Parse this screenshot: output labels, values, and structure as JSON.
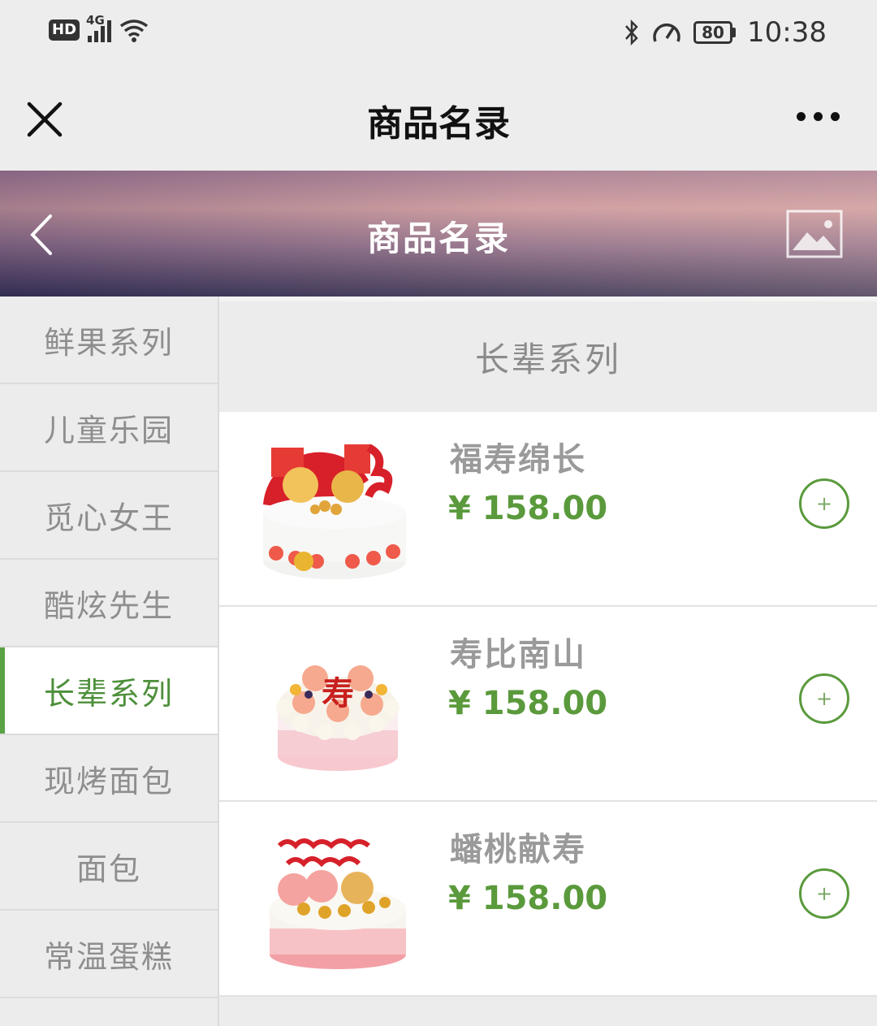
{
  "status_bar": {
    "hd": "HD",
    "network": "4G",
    "battery": "80",
    "time": "10:38"
  },
  "nav": {
    "title": "商品名录"
  },
  "banner": {
    "title": "商品名录"
  },
  "sidebar": {
    "items": [
      {
        "label": "鲜果系列"
      },
      {
        "label": "儿童乐园"
      },
      {
        "label": "觅心女王"
      },
      {
        "label": "酷炫先生"
      },
      {
        "label": "长辈系列"
      },
      {
        "label": "现烤面包"
      },
      {
        "label": "面包"
      },
      {
        "label": "常温蛋糕"
      }
    ],
    "active_index": 4
  },
  "content": {
    "category_title": "长辈系列",
    "products": [
      {
        "name": "福寿绵长",
        "price": "¥ 158.00",
        "add": "+"
      },
      {
        "name": "寿比南山",
        "price": "¥ 158.00",
        "add": "+"
      },
      {
        "name": "蟠桃献寿",
        "price": "¥ 158.00",
        "add": "+"
      }
    ]
  },
  "colors": {
    "accent": "#5a9a3c",
    "sidebar_bg": "#ececec",
    "banner_dark": "#2e2e52"
  }
}
